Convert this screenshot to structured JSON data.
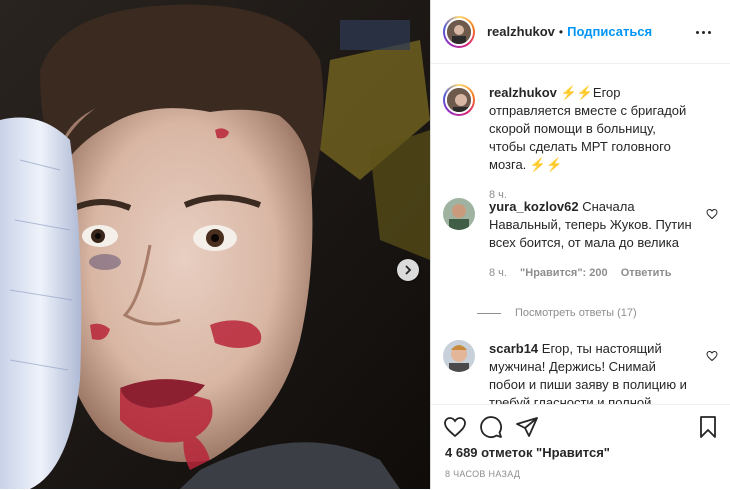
{
  "post": {
    "author": "realzhukov",
    "follow_label": "Подписаться",
    "separator": "•"
  },
  "caption": {
    "author": "realzhukov",
    "text": "⚡⚡Егор отправляется вместе с бригадой скорой помощи в больницу, чтобы сделать МРТ головного мозга. ⚡⚡",
    "time": "8 ч."
  },
  "comments": [
    {
      "author": "yura_kozlov62",
      "text": "Сначала Навальный, теперь Жуков. Путин всех боится, от мала до велика",
      "time": "8 ч.",
      "likes": "\"Нравится\": 200",
      "reply_label": "Ответить",
      "view_replies": "Посмотреть ответы (17)"
    },
    {
      "author": "scarb14",
      "text": "Егор, ты настоящий мужчина! Держись! Снимай побои и пиши заяву в полицию и требуй гласности и полной"
    }
  ],
  "footer": {
    "likes": "4 689 отметок \"Нравится\"",
    "timestamp": "8 ЧАСОВ НАЗАД"
  },
  "icons": {
    "like": "heart-icon",
    "comment": "comment-icon",
    "share": "share-icon",
    "save": "bookmark-icon",
    "next": "chevron-right-icon",
    "more": "more-icon"
  },
  "colors": {
    "follow": "#0095f6",
    "text": "#262626",
    "muted": "#8e8e8e"
  }
}
